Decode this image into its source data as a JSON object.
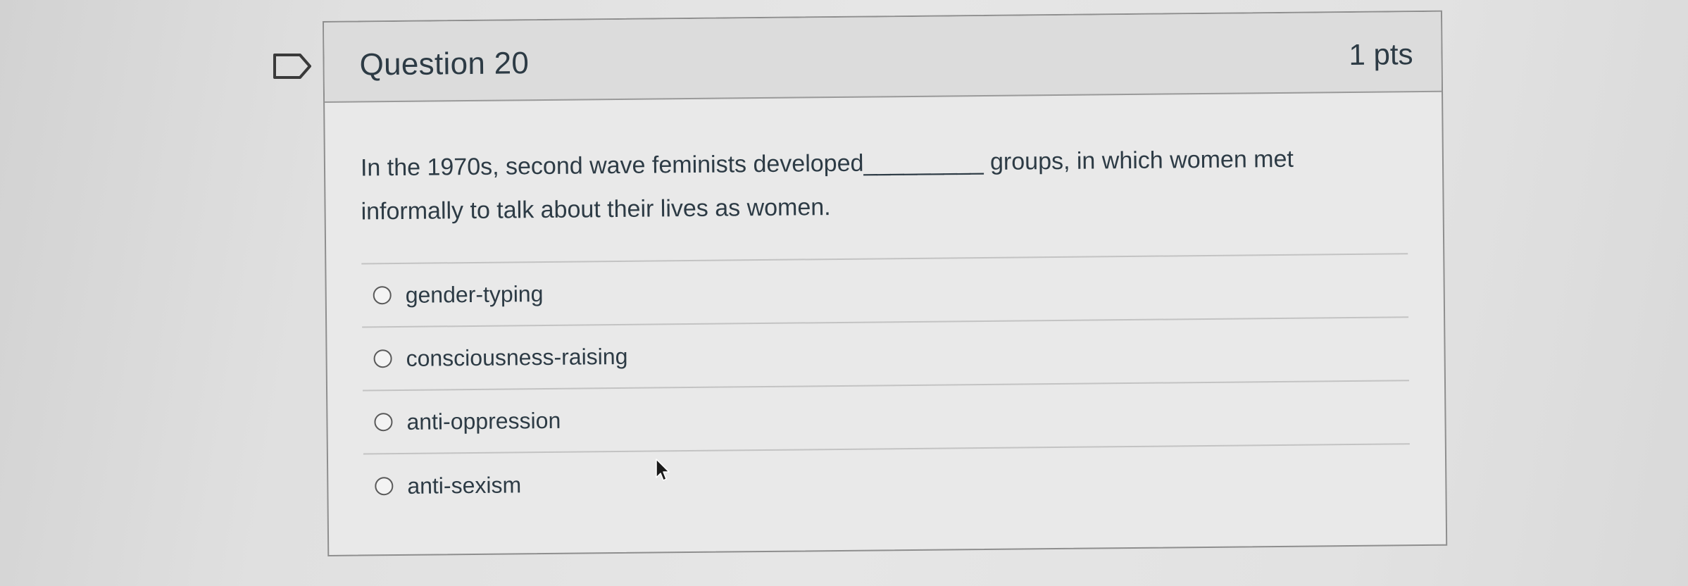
{
  "question": {
    "title": "Question 20",
    "points": "1 pts",
    "text": "In the 1970s, second wave feminists developed_________ groups, in which women met informally to talk about their lives as women.",
    "answers": [
      {
        "label": "gender-typing",
        "selected": false
      },
      {
        "label": "consciousness-raising",
        "selected": false
      },
      {
        "label": "anti-oppression",
        "selected": false
      },
      {
        "label": "anti-sexism",
        "selected": false
      }
    ]
  },
  "icons": {
    "flag": "flag-bookmark-icon",
    "cursor": "mouse-pointer-icon"
  },
  "colors": {
    "text": "#2d3b45",
    "header_bg": "#dcdcdc",
    "card_bg": "#e9e9e9",
    "border": "#8e8e8e"
  }
}
